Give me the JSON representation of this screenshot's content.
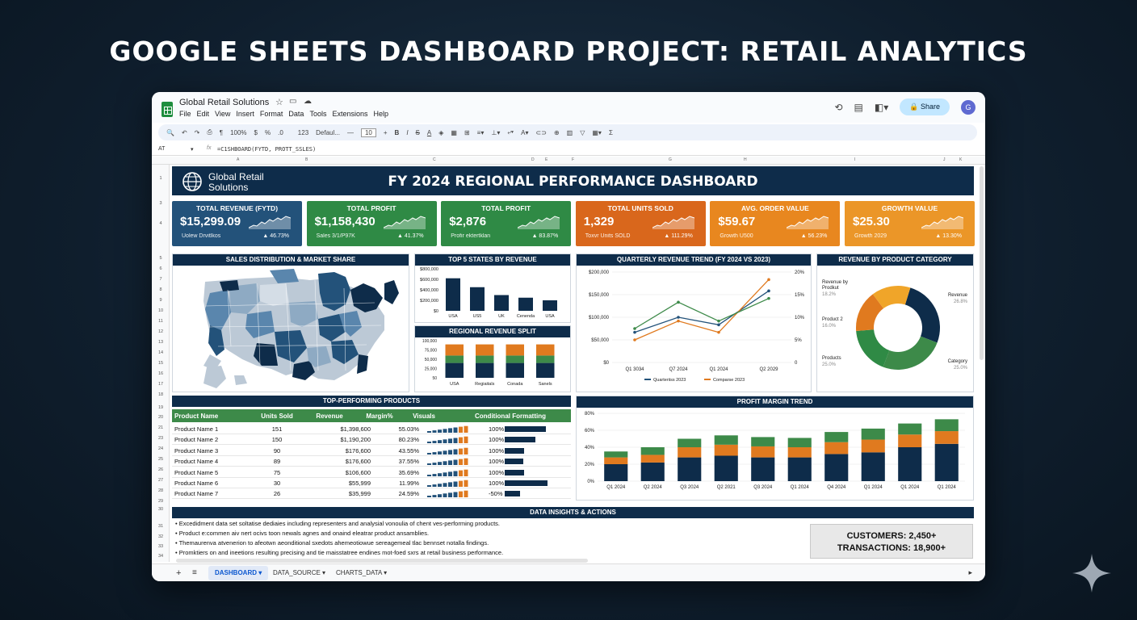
{
  "banner": "GOOGLE SHEETS DASHBOARD PROJECT: RETAIL ANALYTICS",
  "app": {
    "title": "Global Retail Solutions",
    "menu": [
      "File",
      "Edit",
      "View",
      "Insert",
      "Format",
      "Data",
      "Tools",
      "Extensions",
      "Help"
    ],
    "share_label": "Share",
    "avatar_letter": "G"
  },
  "toolbar": {
    "zoom": "100%",
    "currency": "$",
    "percent": "%",
    "decimals": ".0",
    ".00": ".00",
    "number_format": "123",
    "font": "Defaul...",
    "font_size": "10",
    "bold": "B",
    "italic": "I",
    "strike": "S",
    "textcolor": "A"
  },
  "formula_bar": {
    "cell": "AT",
    "formula": "=C1SHBOARD(FYTD, PROTT_SSLES)"
  },
  "column_letters": [
    "A",
    "B",
    "C",
    "D",
    "E",
    "F",
    "G",
    "H",
    "I",
    "J",
    "K"
  ],
  "row_numbers": [
    "1",
    "3",
    "4",
    "5",
    "6",
    "7",
    "8",
    "9",
    "10",
    "11",
    "12",
    "13",
    "14",
    "15",
    "16",
    "17",
    "18",
    "19",
    "20",
    "21",
    "23",
    "24",
    "25",
    "26",
    "27",
    "28",
    "29",
    "30",
    "31",
    "32",
    "33",
    "34",
    "35"
  ],
  "dashboard": {
    "brand_line1": "Global Retail",
    "brand_line2": "Solutions",
    "title": "FY 2024 REGIONAL PERFORMANCE DASHBOARD",
    "colors": {
      "navy": "#0e2c4a",
      "blue": "#27587f",
      "green": "#3d8a49",
      "orange": "#e07a1f",
      "amber": "#f0a529"
    },
    "kpis": [
      {
        "title": "TOTAL REVENUE (FYTD)",
        "value": "$15,299.09",
        "sub": "Uolew Drvitlkos",
        "change": "▲ 46.73%",
        "color": "#23527a"
      },
      {
        "title": "TOTAL PROFIT",
        "value": "$1,158,430",
        "sub": "Sales 3/1/P97K",
        "change": "▲ 41.37%",
        "color": "#2f8a45"
      },
      {
        "title": "TOTAL PROFIT",
        "value": "$2,876",
        "sub": "Profir ektertklan",
        "change": "▲ 83.87%",
        "color": "#2f8a45"
      },
      {
        "title": "TOTAL UNITS SOLD",
        "value": "1,329",
        "sub": "Toxvr Units SOLD",
        "change": "▲ 111.29%",
        "color": "#d9671c"
      },
      {
        "title": "AVG. ORDER VALUE",
        "value": "$59.67",
        "sub": "Growth U500",
        "change": "▲ 56.23%",
        "color": "#e8871f"
      },
      {
        "title": "GROWTH VALUE",
        "value": "$25.30",
        "sub": "Growth 2029",
        "change": "▲ 13.30%",
        "color": "#eb9628"
      }
    ],
    "panels": {
      "map": "SALES DISTRIBUTION & MARKET SHARE",
      "top_states": "TOP 5 STATES BY REVENUE",
      "regional": "REGIONAL REVENUE SPLIT",
      "quarterly": "QUARTERLY REVENUE TREND (FY 2024 VS 2023)",
      "category": "REVENUE BY PRODUCT CATEGORY",
      "products": "TOP-PERFORMING PRODUCTS",
      "profit": "PROFIT MARGIN TREND"
    },
    "products": {
      "headers": [
        "Product Name",
        "Units Sold",
        "Revenue",
        "Margin%",
        "Visuals",
        "Conditional Formatting"
      ],
      "rows": [
        {
          "name": "Product Name 1",
          "units": "151",
          "revenue": "$1,398,600",
          "margin": "55.03%",
          "cf": "100%",
          "bar": 0.95
        },
        {
          "name": "Product Name 2",
          "units": "150",
          "revenue": "$1,190,200",
          "margin": "80.23%",
          "cf": "100%",
          "bar": 0.7
        },
        {
          "name": "Product Name 3",
          "units": "90",
          "revenue": "$176,600",
          "margin": "43.55%",
          "cf": "100%",
          "bar": 0.45
        },
        {
          "name": "Product Name 4",
          "units": "89",
          "revenue": "$176,600",
          "margin": "37.55%",
          "cf": "100%",
          "bar": 0.42
        },
        {
          "name": "Product Name 5",
          "units": "75",
          "revenue": "$106,600",
          "margin": "35.69%",
          "cf": "100%",
          "bar": 0.45
        },
        {
          "name": "Product Name 6",
          "units": "30",
          "revenue": "$55,999",
          "margin": "11.99%",
          "cf": "100%",
          "bar": 0.98
        },
        {
          "name": "Product Name 7",
          "units": "26",
          "revenue": "$35,999",
          "margin": "24.59%",
          "cf": "-50%",
          "bar": 0.35
        }
      ]
    },
    "insights": {
      "title": "DATA INSIGHTS & ACTIONS",
      "items": [
        "• Excedidment data set soltatise dediaies including representers and analysial vonoulia of chent ves-performing products.",
        "• Product e:commen aiv nert ocivs toon newals agnes and onaind eleatrar product ansamblies.",
        "• Themaurenva atvenerion to afeotwn aeonditional sxedots ahemeotiowue sereagemeal tlac bennset notalla findings.",
        "• Promktiers on and ineetions resulting precising and tie maisstatree endines mot-foed sxrs at retail business performance."
      ],
      "customers": "CUSTOMERS: 2,450+",
      "transactions": "TRANSACTIONS: 18,900+"
    }
  },
  "tabs": [
    {
      "label": "DASHBOARD ▾",
      "active": true
    },
    {
      "label": "DATA_SOURCE ▾",
      "active": false
    },
    {
      "label": "CHARTS_DATA ▾",
      "active": false
    }
  ],
  "chart_data": [
    {
      "type": "bar",
      "title": "TOP 5 STATES BY REVENUE",
      "categories": [
        "USA",
        "US5",
        "UK",
        "Cenenda",
        "USA"
      ],
      "values": [
        620000,
        450000,
        300000,
        250000,
        200000
      ],
      "ylim": [
        0,
        800000
      ],
      "yticks": [
        "$800,000",
        "$600,000",
        "$400,000",
        "$200,000",
        "$0"
      ]
    },
    {
      "type": "bar",
      "title": "REGIONAL REVENUE SPLIT",
      "categories": [
        "USA",
        "Regiaitals",
        "Conada",
        "Sanels"
      ],
      "series": [
        {
          "name": "base",
          "values": [
            40,
            40,
            40,
            40
          ],
          "color": "#0e2c4a"
        },
        {
          "name": "mid",
          "values": [
            20,
            20,
            20,
            20
          ],
          "color": "#3d8a49"
        },
        {
          "name": "top",
          "values": [
            30,
            30,
            30,
            30
          ],
          "color": "#e07a1f"
        }
      ],
      "ylim": [
        0,
        100
      ],
      "yticks": [
        "100,000",
        "75,000",
        "50,000",
        "25,000",
        "50"
      ]
    },
    {
      "type": "line",
      "title": "QUARTERLY REVENUE TREND (FY 2024 VS 2023)",
      "categories": [
        "Q1 3034",
        "Q7 2024",
        "Q1 2024",
        "Q2 2029"
      ],
      "series": [
        {
          "name": "Quarteriiss 2023",
          "color": "#23527a",
          "values": [
            40,
            60,
            50,
            95
          ]
        },
        {
          "name": "Comparse 2023",
          "color": "#e07a1f",
          "values": [
            30,
            55,
            40,
            110
          ]
        },
        {
          "name": "",
          "color": "#3d8a49",
          "values": [
            45,
            80,
            55,
            85
          ]
        }
      ],
      "yticks_left": [
        "$200,000",
        "$150,000",
        "$100,000",
        "$50,000",
        "$0"
      ],
      "yticks_right": [
        "20%",
        "15%",
        "10%",
        "5%",
        "0"
      ]
    },
    {
      "type": "pie",
      "title": "REVENUE BY PRODUCT CATEGORY",
      "donut": true,
      "slices": [
        {
          "value": 26,
          "color": "#0e2c4a"
        },
        {
          "value": 25,
          "color": "#3d8a49"
        },
        {
          "value": 18,
          "color": "#2f8a45"
        },
        {
          "value": 16,
          "color": "#e07a1f"
        },
        {
          "value": 15,
          "color": "#f0a529"
        }
      ],
      "labels": [
        {
          "text": "Revenue by",
          "sub": "Prodkut",
          "pct": "18.2%"
        },
        {
          "text": "Product 2",
          "sub": "",
          "pct": "16.0%"
        },
        {
          "text": "Products",
          "sub": "",
          "pct": "25.0%"
        },
        {
          "text": "Revenue",
          "sub": "",
          "pct": "26.8%"
        },
        {
          "text": "Category",
          "sub": "",
          "pct": "25.0%"
        }
      ]
    },
    {
      "type": "bar",
      "title": "PROFIT MARGIN TREND",
      "categories": [
        "Q1 2024",
        "Q2 2024",
        "Q3 2024",
        "Q2 2021",
        "Q3 2024",
        "Q1 2024",
        "Q4 2024",
        "Q1 2024",
        "Q1 2024",
        "Q1 2024"
      ],
      "series": [
        {
          "name": "navy",
          "color": "#0e2c4a",
          "values": [
            20,
            22,
            28,
            30,
            28,
            28,
            32,
            34,
            40,
            44
          ]
        },
        {
          "name": "orange",
          "color": "#e07a1f",
          "values": [
            8,
            9,
            12,
            13,
            13,
            12,
            14,
            15,
            15,
            15
          ]
        },
        {
          "name": "green",
          "color": "#3d8a49",
          "values": [
            7,
            9,
            10,
            11,
            11,
            11,
            12,
            13,
            13,
            14
          ]
        }
      ],
      "ylim": [
        0,
        80
      ],
      "yticks": [
        "80%",
        "60%",
        "40%",
        "20%",
        "0%"
      ]
    }
  ]
}
